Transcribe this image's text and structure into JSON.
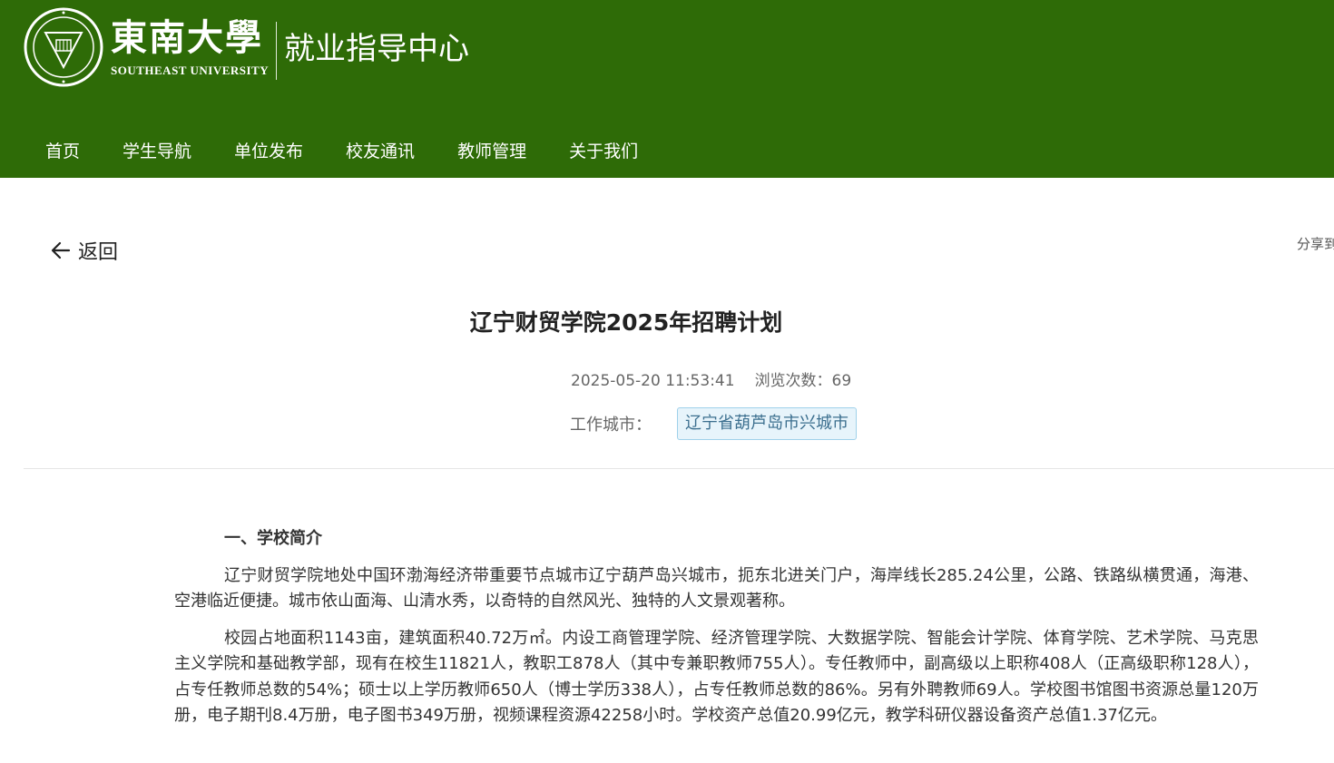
{
  "header": {
    "university_cn": "東南大學",
    "university_en": "SOUTHEAST UNIVERSITY",
    "department": "就业指导中心",
    "brand_color": "#2e6b07"
  },
  "nav": {
    "items": [
      {
        "label": "首页"
      },
      {
        "label": "学生导航"
      },
      {
        "label": "单位发布"
      },
      {
        "label": "校友通讯"
      },
      {
        "label": "教师管理"
      },
      {
        "label": "关于我们"
      }
    ]
  },
  "back": {
    "label": "返回",
    "icon": "arrow-left-icon"
  },
  "share": {
    "label": "分享到"
  },
  "article": {
    "title": "辽宁财贸学院2025年招聘计划",
    "datetime": "2025-05-20 11:53:41",
    "views_label": "浏览次数：69",
    "city_label": "工作城市：",
    "city_value": "辽宁省葫芦岛市兴城市",
    "section1_heading": "一、学校简介",
    "para1": "辽宁财贸学院地处中国环渤海经济带重要节点城市辽宁葫芦岛兴城市，扼东北进关门户，海岸线长285.24公里，公路、铁路纵横贯通，海港、空港临近便捷。城市依山面海、山清水秀，以奇特的自然风光、独特的人文景观著称。",
    "para2": "校园占地面积1143亩，建筑面积40.72万㎡。内设工商管理学院、经济管理学院、大数据学院、智能会计学院、体育学院、艺术学院、马克思主义学院和基础教学部，现有在校生11821人，教职工878人（其中专兼职教师755人）。专任教师中，副高级以上职称408人（正高级职称128人），占专任教师总数的54%；硕士以上学历教师650人（博士学历338人），占专任教师总数的86%。另有外聘教师69人。学校图书馆图书资源总量120万册，电子期刊8.4万册，电子图书349万册，视频课程资源42258小时。学校资产总值20.99亿元，教学科研仪器设备资产总值1.37亿元。"
  }
}
